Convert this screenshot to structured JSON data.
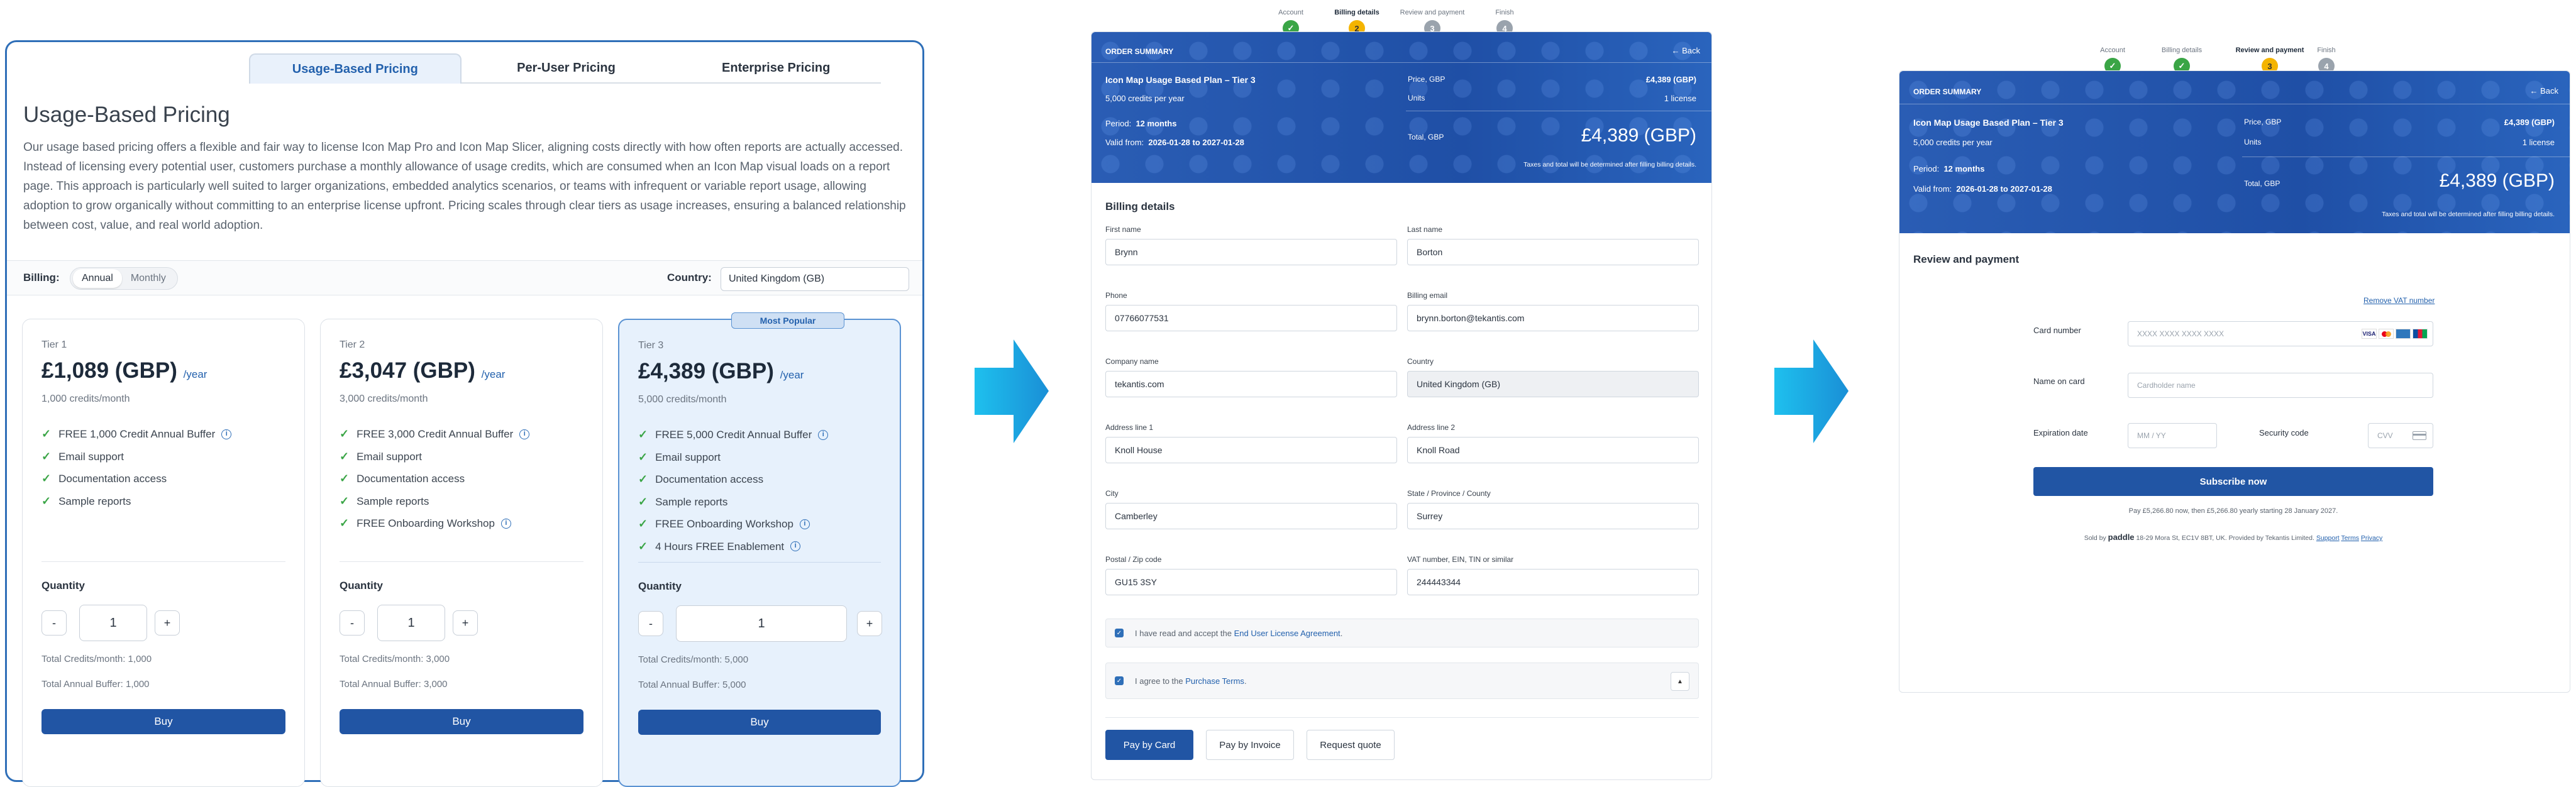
{
  "panel1": {
    "tabs": [
      "Usage-Based Pricing",
      "Per-User Pricing",
      "Enterprise Pricing"
    ],
    "title": "Usage-Based Pricing",
    "description": "Our usage based pricing offers a flexible and fair way to license Icon Map Pro and Icon Map Slicer, aligning costs directly with how often reports are actually accessed. Instead of licensing every potential user, customers purchase a monthly allowance of usage credits, which are consumed when an Icon Map visual loads on a report page. This approach is particularly well suited to larger organizations, embedded analytics scenarios, or teams with infrequent or variable report usage, allowing adoption to grow organically without committing to an enterprise license upfront. Pricing scales through clear tiers as usage increases, ensuring a balanced relationship between cost, value, and real world adoption.",
    "billing_label": "Billing:",
    "billing_options": [
      "Annual",
      "Monthly"
    ],
    "country_label": "Country:",
    "country_value": "United Kingdom (GB)",
    "quantity_label": "Quantity",
    "buy_label": "Buy",
    "popular_badge": "Most Popular",
    "tiers": [
      {
        "name": "Tier 1",
        "price": "£1,089 (GBP)",
        "per": "/year",
        "credits": "1,000 credits/month",
        "features": [
          "FREE 1,000 Credit Annual Buffer",
          "Email support",
          "Documentation access",
          "Sample reports"
        ],
        "info": [
          true,
          false,
          false,
          false
        ],
        "qty": "1",
        "total_credits": "Total Credits/month: 1,000",
        "total_buffer": "Total Annual Buffer: 1,000"
      },
      {
        "name": "Tier 2",
        "price": "£3,047 (GBP)",
        "per": "/year",
        "credits": "3,000 credits/month",
        "features": [
          "FREE 3,000 Credit Annual Buffer",
          "Email support",
          "Documentation access",
          "Sample reports",
          "FREE Onboarding Workshop"
        ],
        "info": [
          true,
          false,
          false,
          false,
          true
        ],
        "qty": "1",
        "total_credits": "Total Credits/month: 3,000",
        "total_buffer": "Total Annual Buffer: 3,000"
      },
      {
        "name": "Tier 3",
        "price": "£4,389 (GBP)",
        "per": "/year",
        "credits": "5,000 credits/month",
        "features": [
          "FREE 5,000 Credit Annual Buffer",
          "Email support",
          "Documentation access",
          "Sample reports",
          "FREE Onboarding Workshop",
          "4 Hours FREE Enablement"
        ],
        "info": [
          true,
          false,
          false,
          false,
          true,
          true
        ],
        "qty": "1",
        "total_credits": "Total Credits/month: 5,000",
        "total_buffer": "Total Annual Buffer: 5,000"
      }
    ]
  },
  "stepper2": {
    "steps": [
      "Account",
      "Billing details",
      "Review and payment",
      "Finish"
    ],
    "numbers": [
      "✓",
      "2",
      "3",
      "4"
    ],
    "current": 1
  },
  "stepper3": {
    "steps": [
      "Account",
      "Billing details",
      "Review and payment",
      "Finish"
    ],
    "numbers": [
      "✓",
      "✓",
      "3",
      "4"
    ],
    "current": 2
  },
  "summary": {
    "heading": "ORDER SUMMARY",
    "back": "← Back",
    "plan": "Icon Map Usage Based Plan – Tier 3",
    "credits": "5,000 credits per year",
    "period_label": "Period:",
    "period_value": "12 months",
    "valid_label": "Valid from:",
    "valid_value": "2026-01-28 to 2027-01-28",
    "price_label": "Price, GBP",
    "price_value": "£4,389 (GBP)",
    "units_label": "Units",
    "units_value": "1 license",
    "total_label": "Total, GBP",
    "total_value": "£4,389 (GBP)",
    "tax_note": "Taxes and total will be determined after filling billing details."
  },
  "billing": {
    "heading": "Billing details",
    "fields": {
      "first_name": {
        "label": "First name",
        "value": "Brynn"
      },
      "last_name": {
        "label": "Last name",
        "value": "Borton"
      },
      "phone": {
        "label": "Phone",
        "value": "07766077531"
      },
      "email": {
        "label": "Billing email",
        "value": "brynn.borton@tekantis.com"
      },
      "company": {
        "label": "Company name",
        "value": "tekantis.com"
      },
      "country": {
        "label": "Country",
        "value": "United Kingdom (GB)"
      },
      "addr1": {
        "label": "Address line 1",
        "value": "Knoll House"
      },
      "addr2": {
        "label": "Address line 2",
        "value": "Knoll Road"
      },
      "city": {
        "label": "City",
        "value": "Camberley"
      },
      "state": {
        "label": "State / Province / County",
        "value": "Surrey"
      },
      "postal": {
        "label": "Postal / Zip code",
        "value": "GU15 3SY"
      },
      "vat": {
        "label": "VAT number, EIN, TIN or similar",
        "value": "244443344"
      }
    },
    "eula_prefix": "I have read and accept the ",
    "eula_link": "End User License Agreement",
    "eula_suffix": ".",
    "terms_prefix": "I agree to the ",
    "terms_link": "Purchase Terms",
    "terms_suffix": ".",
    "buttons": [
      "Pay by Card",
      "Pay by Invoice",
      "Request quote"
    ]
  },
  "payment": {
    "heading": "Review and payment",
    "remove_vat": "Remove VAT number",
    "card_label": "Card number",
    "card_placeholder": "XXXX XXXX XXXX XXXX",
    "name_label": "Name on card",
    "name_placeholder": "Cardholder name",
    "exp_label": "Expiration date",
    "exp_placeholder": "MM / YY",
    "cvv_label": "Security code",
    "cvv_placeholder": "CVV",
    "subscribe": "Subscribe now",
    "pay_note": "Pay £5,266.80 now, then £5,266.80 yearly starting 28 January 2027.",
    "footer_sold": "Sold by",
    "footer_brand": "paddle",
    "footer_addr": "18-29 Mora St, EC1V 8BT, UK. Provided by Tekantis Limited.",
    "footer_support": "Support",
    "footer_terms": "Terms",
    "footer_privacy": "Privacy",
    "card_brands": [
      "VISA",
      "MC",
      "AMEX",
      "JCB"
    ]
  },
  "colors": {
    "primary": "#2155a4",
    "check": "#3aa546",
    "current_step": "#f4b400",
    "arrow": "#1aa3e0"
  }
}
